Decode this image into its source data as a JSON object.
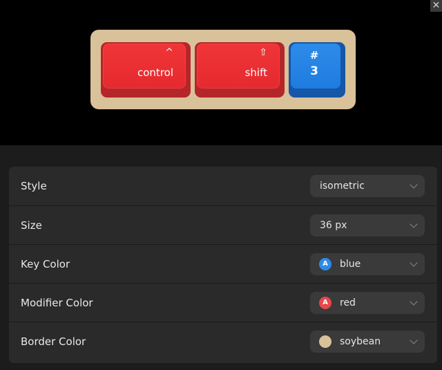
{
  "preview": {
    "keys": [
      {
        "label": "control",
        "glyph": "^",
        "glyph_icon": "caret-up-icon"
      },
      {
        "label": "shift",
        "glyph": "⇧",
        "glyph_icon": "shift-arrow-icon"
      },
      {
        "symbol": "#",
        "main": "3"
      }
    ]
  },
  "close_glyph": "✕",
  "colors": {
    "tray": "#d9c19a",
    "modifier": "#e52a2f",
    "key": "#1f7ce0",
    "blue_swatch": "#2d8be8",
    "red_swatch": "#e5484d",
    "soybean_swatch": "#d9c19a"
  },
  "settings": {
    "style": {
      "label": "Style",
      "value": "isometric"
    },
    "size": {
      "label": "Size",
      "value": "36 px"
    },
    "key_color": {
      "label": "Key Color",
      "value": "blue",
      "swatch_letter": "A"
    },
    "modifier_color": {
      "label": "Modifier Color",
      "value": "red",
      "swatch_letter": "A"
    },
    "border_color": {
      "label": "Border Color",
      "value": "soybean"
    }
  }
}
